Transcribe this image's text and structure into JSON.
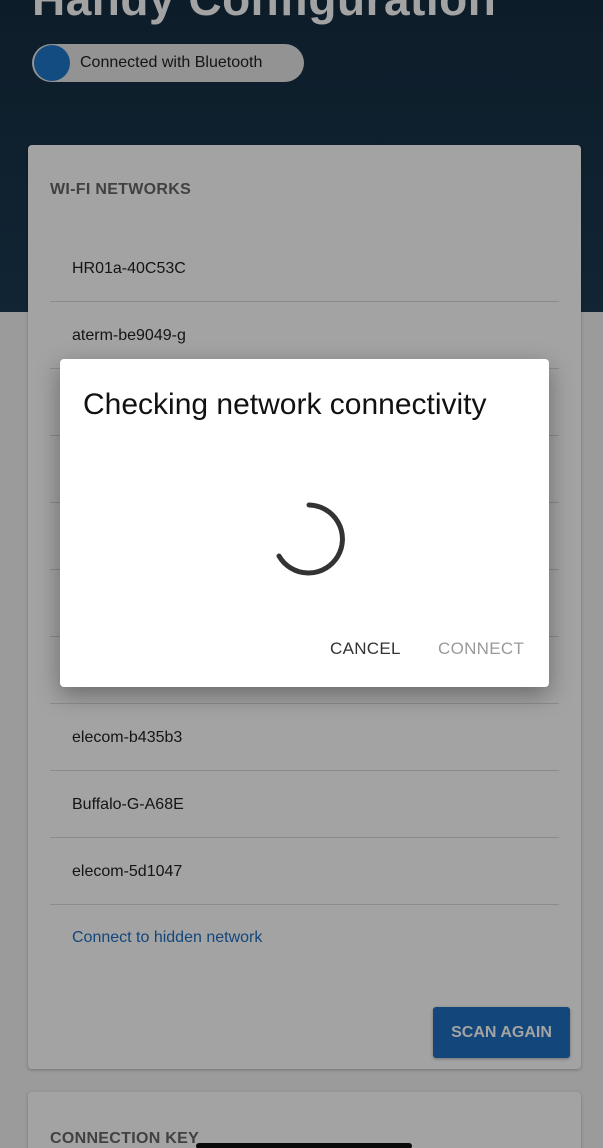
{
  "header": {
    "title": "Handy Configuration",
    "bluetooth_toggle": {
      "label": "Connected with Bluetooth",
      "state": "on"
    }
  },
  "wifi_card": {
    "title": "WI-FI NETWORKS",
    "networks": [
      "HR01a-40C53C",
      "aterm-be9049-g",
      "",
      "",
      "",
      "",
      "",
      "elecom-b435b3",
      "Buffalo-G-A68E",
      "elecom-5d1047"
    ],
    "hidden_network_link": "Connect to hidden network",
    "scan_button": "SCAN AGAIN"
  },
  "connection_key_card": {
    "title": "CONNECTION KEY"
  },
  "dialog": {
    "title": "Checking network connectivity",
    "cancel_label": "CANCEL",
    "connect_label": "CONNECT",
    "connect_enabled": false
  },
  "colors": {
    "header_bg": "#1b3a52",
    "accent": "#1e6ec0",
    "toggle_knob": "#1e78c8"
  }
}
